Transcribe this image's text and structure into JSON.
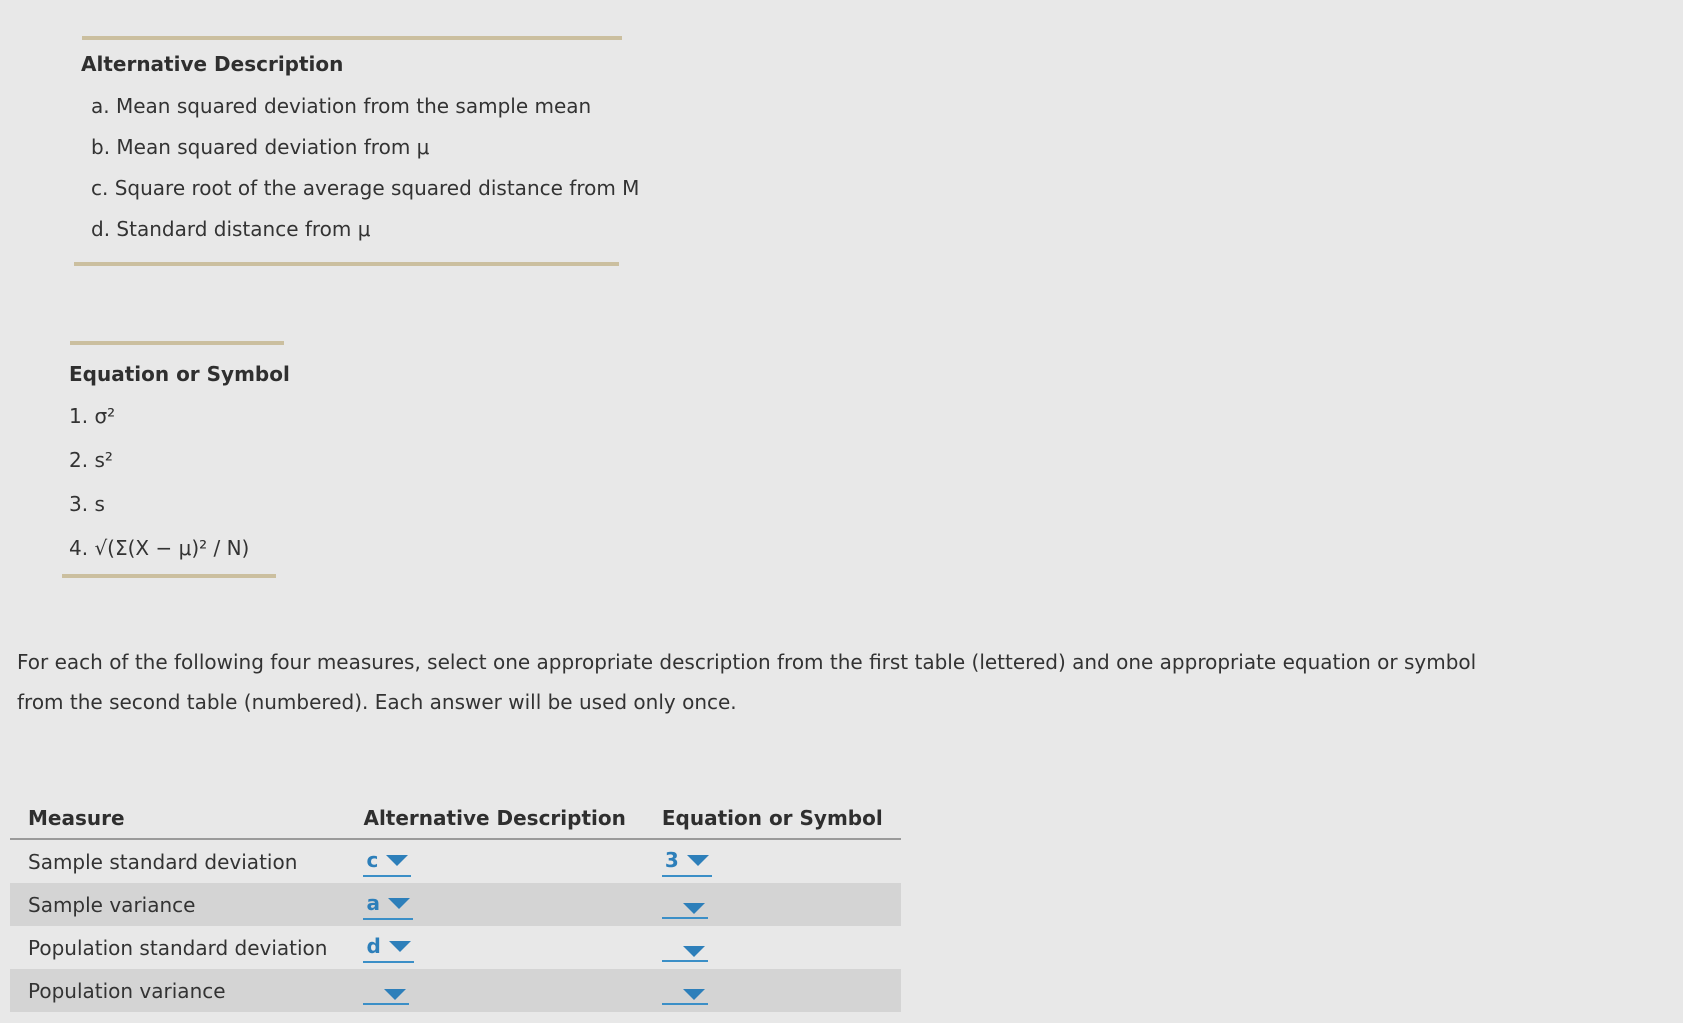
{
  "descriptions": {
    "title": "Alternative Description",
    "items": [
      "a. Mean squared deviation from the sample mean",
      "b. Mean squared deviation from μ",
      "c. Square root of the average squared distance from M",
      "d. Standard distance from μ"
    ]
  },
  "equations": {
    "title": "Equation or Symbol",
    "items": [
      "1. σ²",
      "2. s²",
      "3. s",
      "4. √(Σ(X − μ)² / N)"
    ]
  },
  "instructions": "For each of the following four measures, select one appropriate description from the first table (lettered) and one appropriate equation or symbol from the second table (numbered). Each answer will be used only once.",
  "table": {
    "headers": {
      "measure": "Measure",
      "description": "Alternative Description",
      "equation": "Equation or Symbol"
    },
    "rows": [
      {
        "measure": "Sample standard deviation",
        "description": "c",
        "equation": "3"
      },
      {
        "measure": "Sample variance",
        "description": "a",
        "equation": ""
      },
      {
        "measure": "Population standard deviation",
        "description": "d",
        "equation": ""
      },
      {
        "measure": "Population variance",
        "description": "",
        "equation": ""
      }
    ]
  },
  "colors": {
    "dropdown": "#2d7fba",
    "rule": "#cbbf9f",
    "shaded_row": "#d4d4d4",
    "background": "#e8e8e8"
  },
  "icons": {
    "dropdown_caret": "chevron-down-icon"
  }
}
